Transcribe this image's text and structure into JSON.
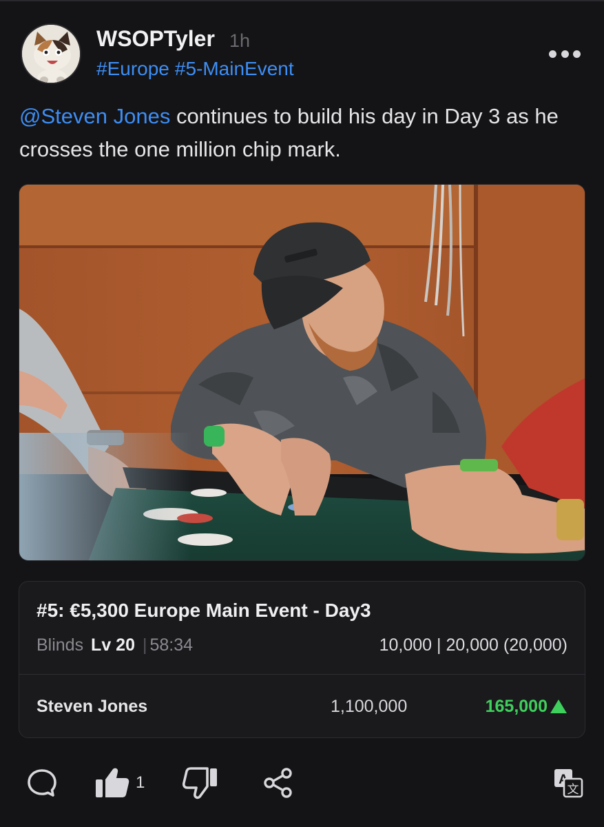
{
  "post": {
    "username": "WSOPTyler",
    "timestamp": "1h",
    "tags": [
      "#Europe",
      "#5-MainEvent"
    ],
    "mention": "@Steven Jones",
    "text": " continues to build his day in Day 3 as he crosses the one million chip mark."
  },
  "event": {
    "title": "#5: €5,300 Europe Main Event - Day3",
    "blinds_label": "Blinds",
    "level": "Lv 20",
    "separator": "|",
    "clock": "58:34",
    "blinds": "10,000 | 20,000 (20,000)"
  },
  "player": {
    "name": "Steven Jones",
    "chips": "1,100,000",
    "change": "165,000"
  },
  "actions": {
    "like_count": "1"
  },
  "icons": {
    "menu": "more-horizontal-icon",
    "comment": "comment-bubble-icon",
    "like": "thumbs-up-icon",
    "dislike": "thumbs-down-icon",
    "share": "share-icon",
    "translate": "translate-icon",
    "trend": "up-arrow-icon"
  },
  "colors": {
    "background": "#141416",
    "link": "#3d8ef5",
    "positive": "#3fcf5c"
  }
}
